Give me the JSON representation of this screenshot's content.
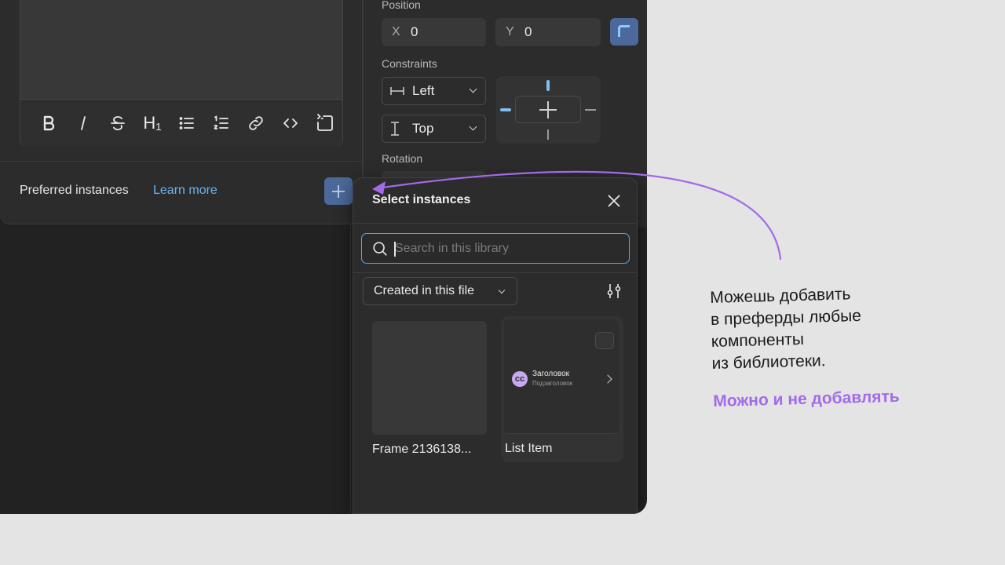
{
  "left_panel": {
    "toolbar": {
      "heading_text": "H₁"
    },
    "preferred_label": "Preferred instances",
    "learn_more": "Learn more"
  },
  "properties": {
    "position_label": "Position",
    "x_key": "X",
    "x_value": "0",
    "y_key": "Y",
    "y_value": "0",
    "constraints_label": "Constraints",
    "horizontal_constraint": "Left",
    "vertical_constraint": "Top",
    "rotation_label": "Rotation"
  },
  "popover": {
    "title": "Select instances",
    "search_placeholder": "Search in this library",
    "filter_label": "Created in this file",
    "cards": [
      {
        "label": "Frame 2136138..."
      },
      {
        "label": "List Item",
        "preview_title": "Заголовок",
        "preview_subtitle": "Подзаголовок",
        "preview_avatar": "cc"
      }
    ]
  },
  "annotation": {
    "lines": [
      "Можешь добавить",
      "в преферды любые",
      "компоненты",
      "из библиотеки."
    ],
    "alt": "Можно и не добавлять",
    "arrow_color": "#a36bea"
  },
  "colors": {
    "accent_blue": "#4b6a9b",
    "link_blue": "#6cb3f0",
    "annotation_purple": "#a36bea"
  }
}
